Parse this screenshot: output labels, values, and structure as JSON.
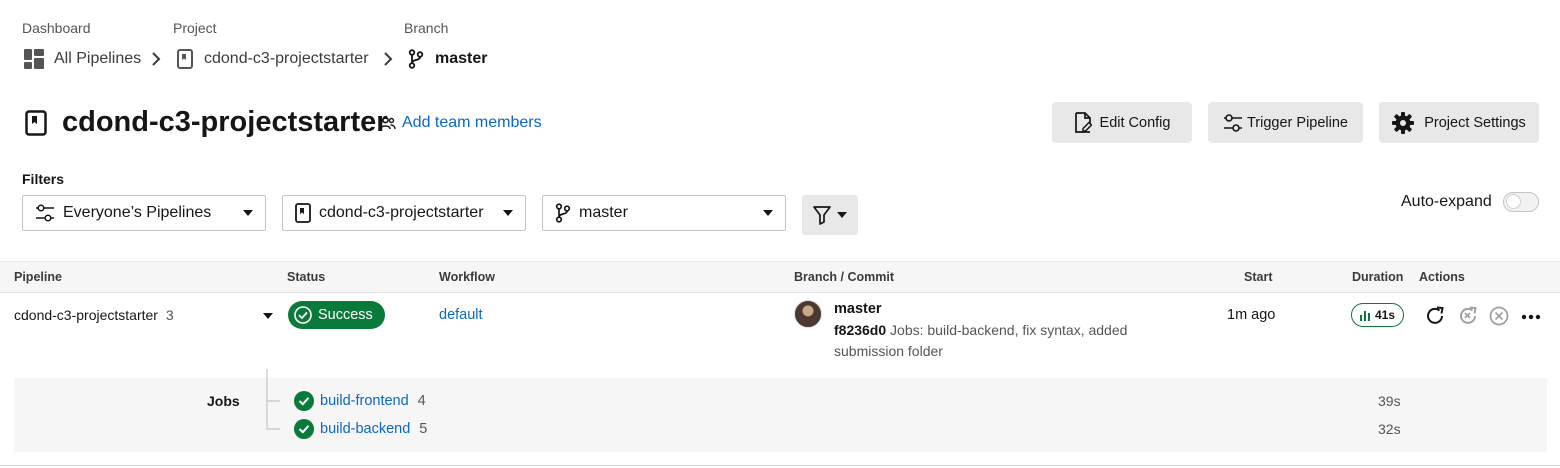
{
  "breadcrumb": {
    "dashboard_label": "Dashboard",
    "project_label": "Project",
    "branch_label": "Branch",
    "dashboard_value": "All Pipelines",
    "project_value": "cdond-c3-projectstarter",
    "branch_value": "master"
  },
  "header": {
    "title": "cdond-c3-projectstarter",
    "add_team": "Add team members",
    "edit_config": "Edit Config",
    "trigger_pipeline": "Trigger Pipeline",
    "project_settings": "Project Settings"
  },
  "filters": {
    "label": "Filters",
    "pipelines_select": "Everyone’s Pipelines",
    "project_select": "cdond-c3-projectstarter",
    "branch_select": "master",
    "auto_expand_label": "Auto-expand",
    "auto_expand_on": false
  },
  "table": {
    "headers": {
      "pipeline": "Pipeline",
      "status": "Status",
      "workflow": "Workflow",
      "branch_commit": "Branch / Commit",
      "start": "Start",
      "duration": "Duration",
      "actions": "Actions"
    },
    "row": {
      "pipeline_name": "cdond-c3-projectstarter",
      "pipeline_number": "3",
      "status": "Success",
      "workflow": "default",
      "branch": "master",
      "commit_hash": "f8236d0",
      "commit_message_line1": "Jobs: build-backend, fix syntax, added",
      "commit_message_line2": "submission folder",
      "start": "1m ago",
      "duration": "41s"
    },
    "jobs": {
      "label": "Jobs",
      "items": [
        {
          "name": "build-frontend",
          "number": "4",
          "duration": "39s"
        },
        {
          "name": "build-backend",
          "number": "5",
          "duration": "32s"
        }
      ]
    }
  },
  "colors": {
    "link": "#0b67c2",
    "success": "#0a7a3b",
    "button_bg": "#e8e8e8",
    "header_bg": "#f6f6f6"
  },
  "icons": {
    "dashboard": "grid-icon",
    "project": "repo-icon",
    "branch": "git-branch-icon",
    "team": "people-icon",
    "edit_config": "file-edit-icon",
    "trigger": "sliders-icon",
    "settings": "gear-icon",
    "filter": "funnel-icon",
    "rerun": "rerun-icon",
    "rerun_failed": "rerun-failed-icon",
    "cancel": "cancel-icon",
    "more": "more-icon"
  }
}
